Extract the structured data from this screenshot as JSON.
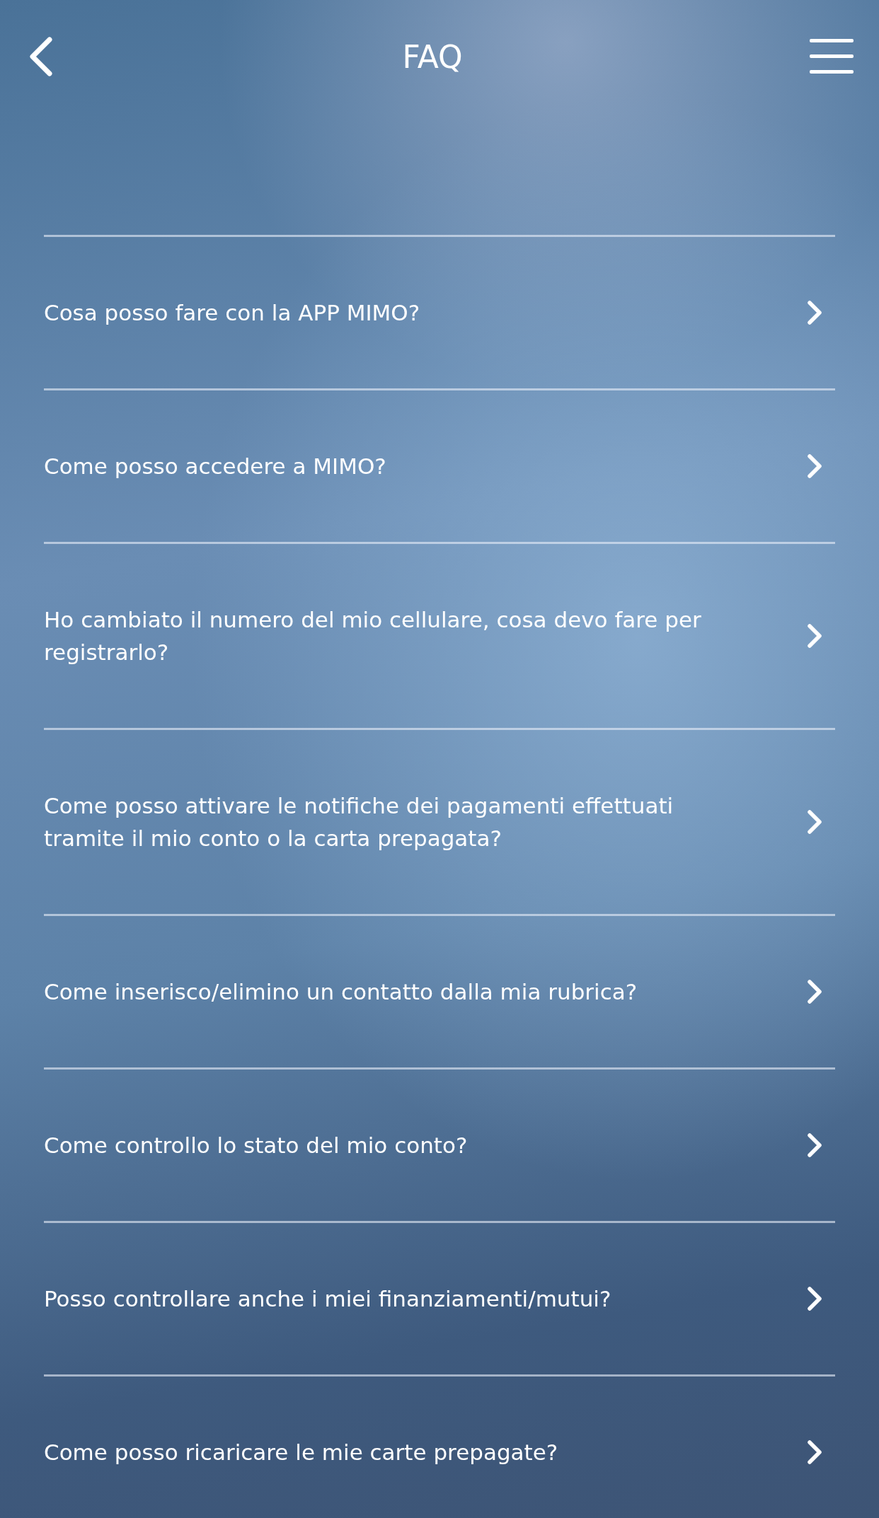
{
  "header": {
    "title": "FAQ"
  },
  "faq_items": [
    {
      "question": "Cosa posso fare con la APP MIMO?"
    },
    {
      "question": "Come posso accedere a MIMO?"
    },
    {
      "question": "Ho cambiato il numero del mio cellulare, cosa devo fare per registrarlo?"
    },
    {
      "question": "Come posso attivare le notifiche dei pagamenti effettuati tramite il mio conto o la carta prepagata?"
    },
    {
      "question": "Come inserisco/elimino un contatto dalla mia rubrica?"
    },
    {
      "question": "Come controllo lo stato del mio conto?"
    },
    {
      "question": "Posso controllare anche i miei finanziamenti/mutui?"
    },
    {
      "question": "Come posso ricaricare le mie carte prepagate?"
    }
  ]
}
